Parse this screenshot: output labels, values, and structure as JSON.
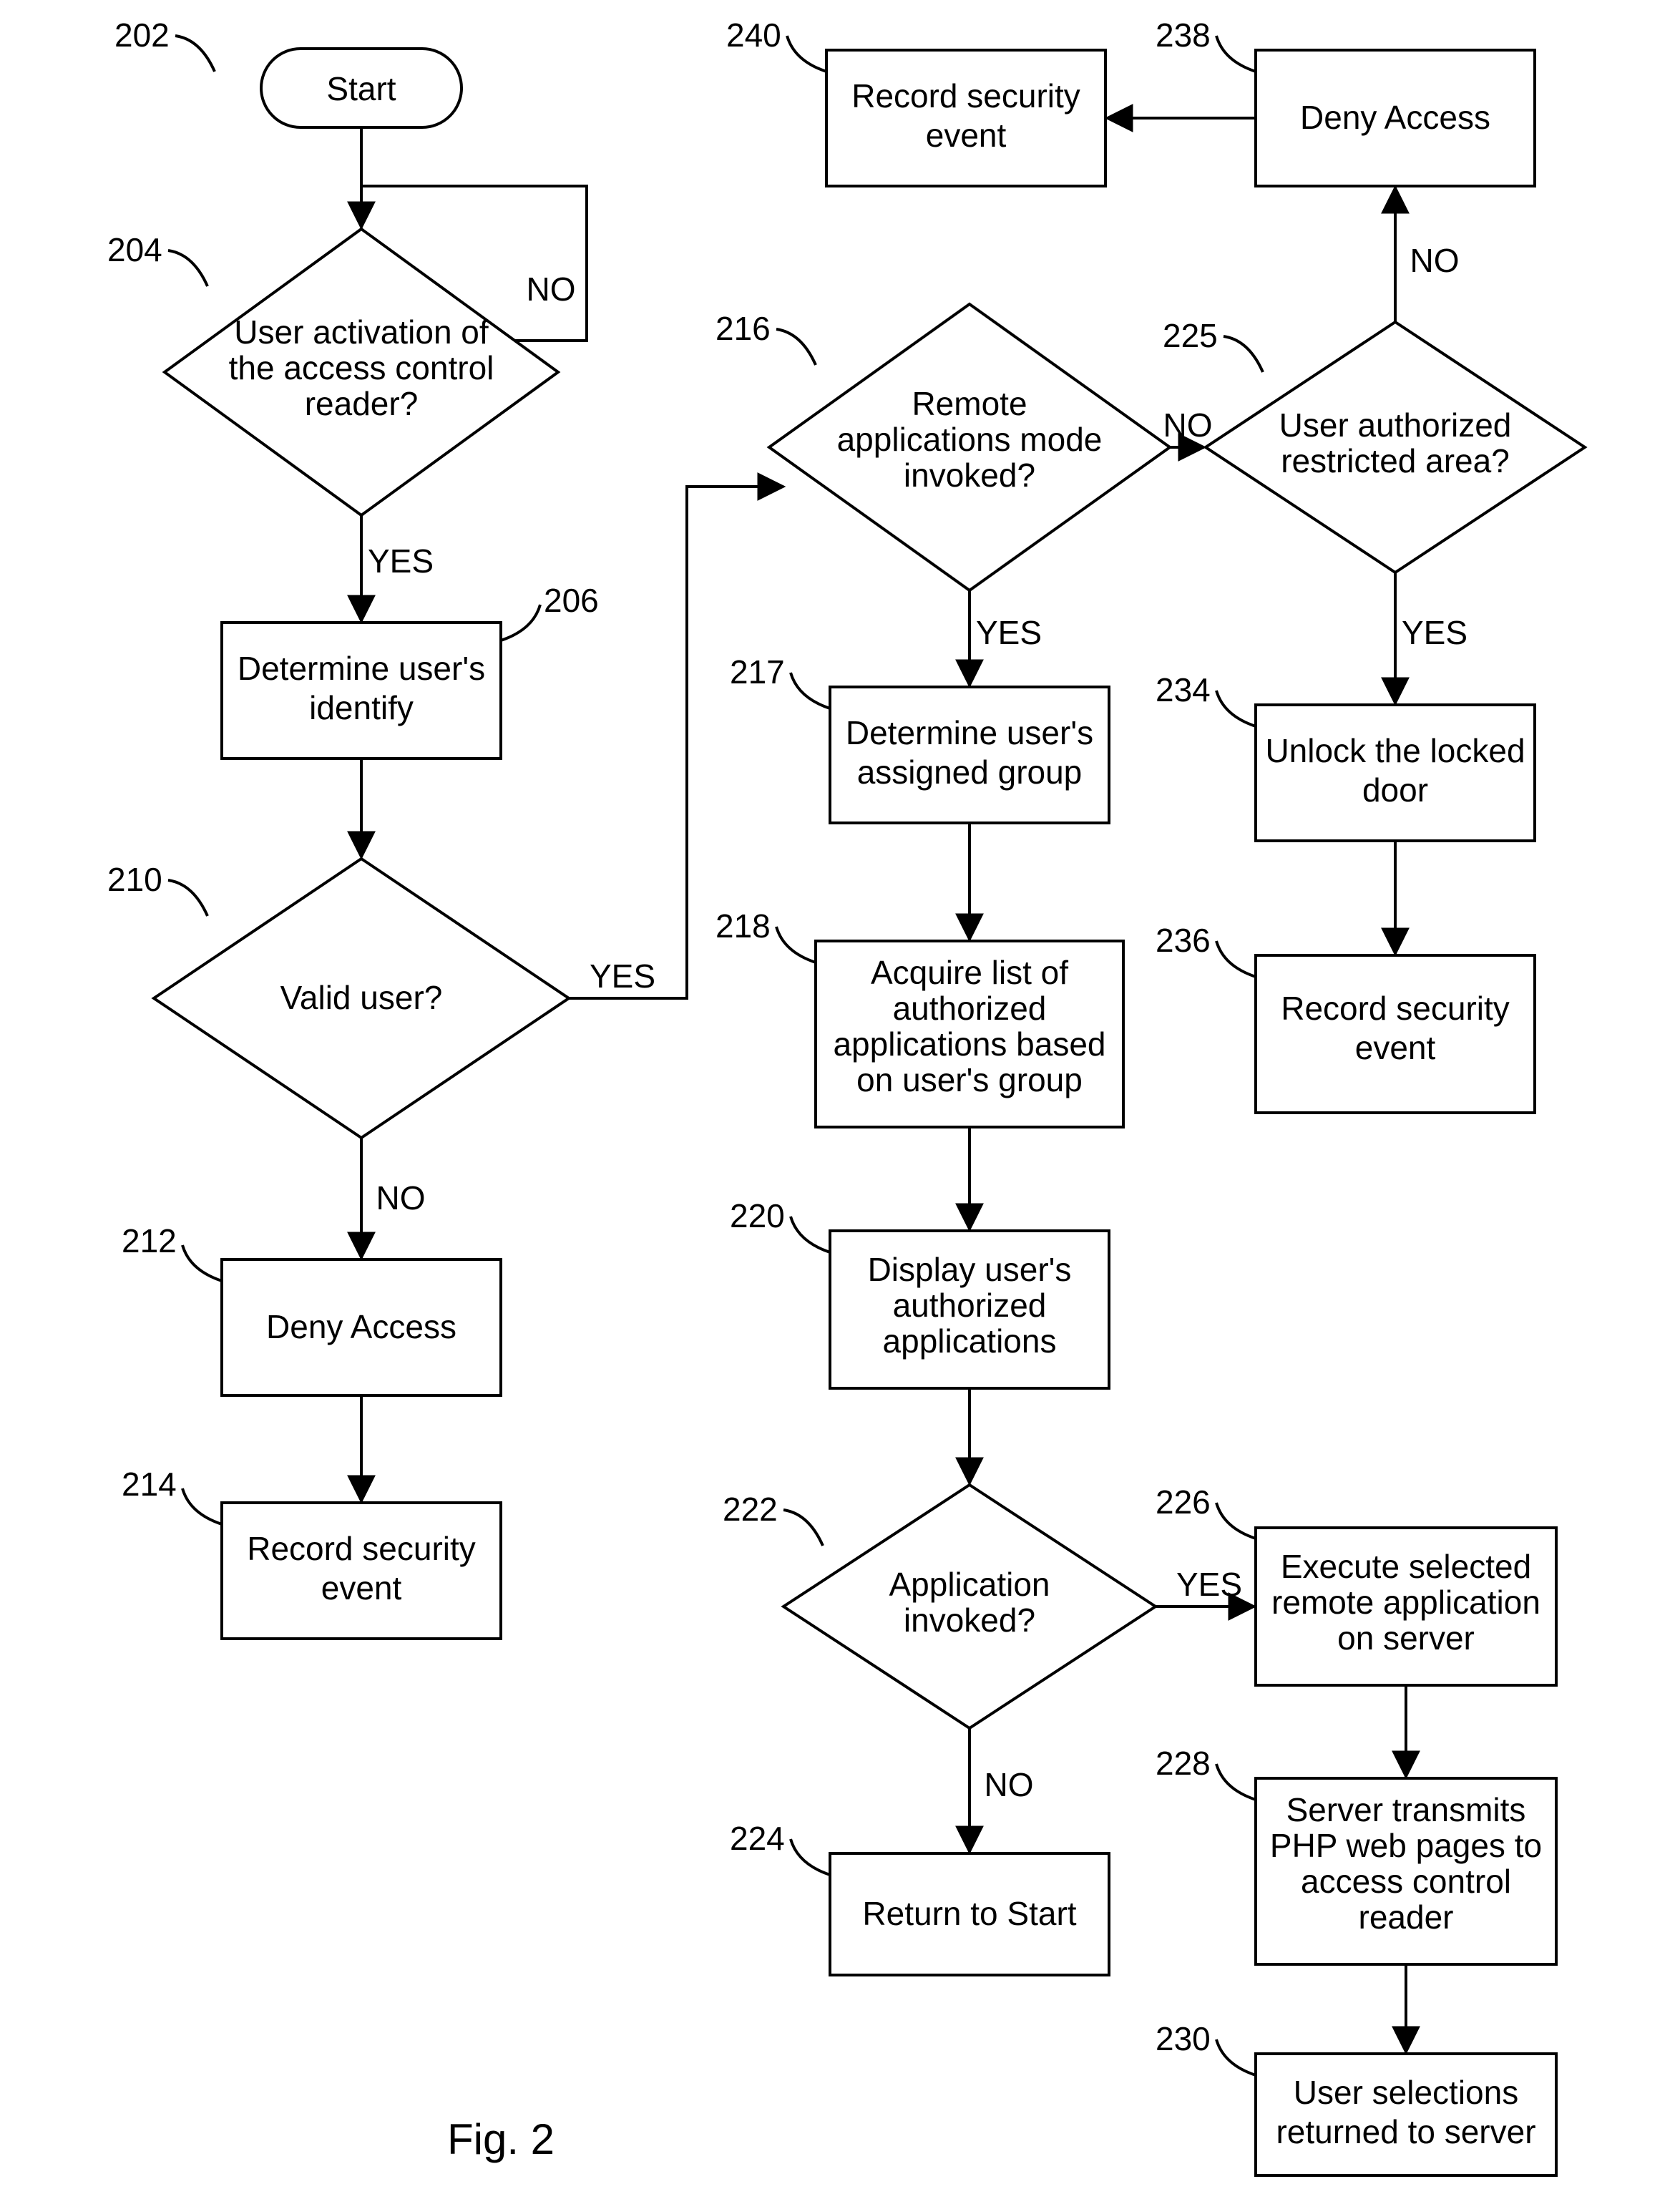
{
  "caption": "Fig. 2",
  "labels": {
    "yes": "YES",
    "no": "NO"
  },
  "nodes": {
    "n202": {
      "ref": "202",
      "type": "terminator",
      "text": [
        "Start"
      ]
    },
    "n204": {
      "ref": "204",
      "type": "decision",
      "text": [
        "User activation of",
        "the access control",
        "reader?"
      ]
    },
    "n206": {
      "ref": "206",
      "type": "process",
      "text": [
        "Determine user's",
        "identify"
      ]
    },
    "n210": {
      "ref": "210",
      "type": "decision",
      "text": [
        "Valid user?"
      ]
    },
    "n212": {
      "ref": "212",
      "type": "process",
      "text": [
        "Deny Access"
      ]
    },
    "n214": {
      "ref": "214",
      "type": "process",
      "text": [
        "Record security",
        "event"
      ]
    },
    "n216": {
      "ref": "216",
      "type": "decision",
      "text": [
        "Remote",
        "applications mode",
        "invoked?"
      ]
    },
    "n217": {
      "ref": "217",
      "type": "process",
      "text": [
        "Determine user's",
        "assigned group"
      ]
    },
    "n218": {
      "ref": "218",
      "type": "process",
      "text": [
        "Acquire list of",
        "authorized",
        "applications based",
        "on user's group"
      ]
    },
    "n220": {
      "ref": "220",
      "type": "process",
      "text": [
        "Display user's",
        "authorized",
        "applications"
      ]
    },
    "n222": {
      "ref": "222",
      "type": "decision",
      "text": [
        "Application",
        "invoked?"
      ]
    },
    "n224": {
      "ref": "224",
      "type": "process",
      "text": [
        "Return to Start"
      ]
    },
    "n225": {
      "ref": "225",
      "type": "decision",
      "text": [
        "User authorized",
        "restricted area?"
      ]
    },
    "n226": {
      "ref": "226",
      "type": "process",
      "text": [
        "Execute selected",
        "remote application",
        "on server"
      ]
    },
    "n228": {
      "ref": "228",
      "type": "process",
      "text": [
        "Server transmits",
        "PHP web pages to",
        "access control",
        "reader"
      ]
    },
    "n230": {
      "ref": "230",
      "type": "process",
      "text": [
        "User selections",
        "returned to server"
      ]
    },
    "n234": {
      "ref": "234",
      "type": "process",
      "text": [
        "Unlock the locked",
        "door"
      ]
    },
    "n236": {
      "ref": "236",
      "type": "process",
      "text": [
        "Record security",
        "event"
      ]
    },
    "n238": {
      "ref": "238",
      "type": "process",
      "text": [
        "Deny Access"
      ]
    },
    "n240": {
      "ref": "240",
      "type": "process",
      "text": [
        "Record security",
        "event"
      ]
    }
  }
}
